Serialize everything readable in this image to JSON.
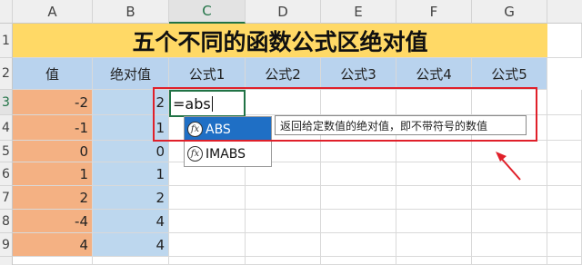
{
  "columns": [
    "A",
    "B",
    "C",
    "D",
    "E",
    "F",
    "G"
  ],
  "rows": [
    "1",
    "2",
    "3",
    "4",
    "5",
    "6",
    "7",
    "8",
    "9"
  ],
  "title": "五个不同的函数公式区绝对值",
  "headers": [
    "值",
    "绝对值",
    "公式1",
    "公式2",
    "公式3",
    "公式4",
    "公式5"
  ],
  "values": [
    "-2",
    "-1",
    "0",
    "1",
    "2",
    "-4",
    "4"
  ],
  "abs_values": [
    "2",
    "1",
    "0",
    "1",
    "2",
    "4",
    "4"
  ],
  "active_cell": {
    "text": "=abs"
  },
  "autocomplete": {
    "items": [
      {
        "label": "ABS",
        "icon": "function-fx-icon"
      },
      {
        "label": "IMABS",
        "icon": "function-fx-icon"
      }
    ]
  },
  "fx_glyph": "fx",
  "tooltip": "返回给定数值的绝对值，即不带符号的数值",
  "colors": {
    "title_bg": "#ffd966",
    "header_bg": "#b9d3ee",
    "col_a": "#f4b183",
    "col_b": "#bdd7ee",
    "highlight": "#e0202a",
    "selection": "#1f6fc5"
  }
}
